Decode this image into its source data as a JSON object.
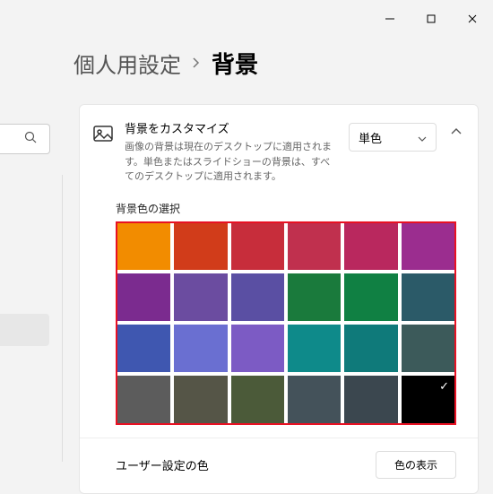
{
  "titlebar": {
    "minimize": "minimize",
    "maximize": "maximize",
    "close": "close"
  },
  "breadcrumb": {
    "parent": "個人用設定",
    "current": "背景"
  },
  "customize": {
    "title": "背景をカスタマイズ",
    "description": "画像の背景は現在のデスクトップに適用されます。単色またはスライドショーの背景は、すべてのデスクトップに適用されます。",
    "dropdown_value": "単色"
  },
  "color_section": {
    "label": "背景色の選択",
    "colors": [
      "#f28c00",
      "#d13c1a",
      "#c72d3b",
      "#c0304e",
      "#b9285e",
      "#9b2d8f",
      "#7b2b8f",
      "#6b4ca0",
      "#5a4fa3",
      "#1a7a3c",
      "#108043",
      "#2b5a68",
      "#3f57b0",
      "#6a6fd1",
      "#7c5bc4",
      "#0e8a8a",
      "#0f7a7a",
      "#3c5a5a",
      "#5c5c5c",
      "#555547",
      "#4b5a39",
      "#44525a",
      "#3b474f",
      "#000000"
    ],
    "selected_index": 23
  },
  "custom": {
    "label": "ユーザー設定の色",
    "button": "色の表示"
  }
}
